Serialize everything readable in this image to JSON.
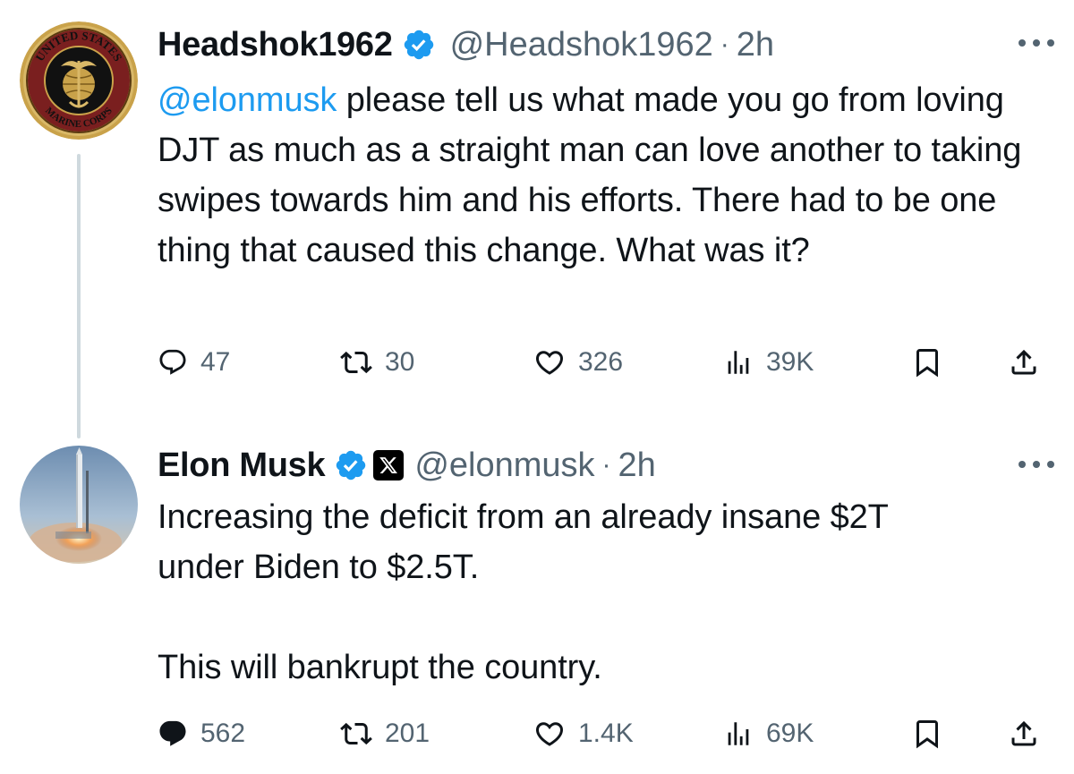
{
  "tweets": [
    {
      "author": {
        "display_name": "Headshok1962",
        "handle": "@Headshok1962",
        "verified": true,
        "avatar": "usmc-seal-avatar",
        "avatar_text_top": "UNITED STATES",
        "avatar_text_bottom": "MARINE CORPS"
      },
      "separator": "·",
      "time": "2h",
      "text": {
        "mention": "@elonmusk",
        "body": " please tell us what made you go from loving DJT as much as a straight man can love another to taking swipes towards him and his efforts.  There had to be one thing that caused this change.  What was it?"
      },
      "stats": {
        "replies": "47",
        "reposts": "30",
        "likes": "326",
        "views": "39K"
      }
    },
    {
      "author": {
        "display_name": "Elon Musk",
        "handle": "@elonmusk",
        "verified": true,
        "affiliation_icon": "x-logo-icon",
        "avatar": "rocket-launch-avatar"
      },
      "separator": "·",
      "time": "2h",
      "text": {
        "body": "Increasing the deficit from an already insane $2T\nunder Biden to $2.5T.\n\nThis will bankrupt the country."
      },
      "stats": {
        "replies": "562",
        "reposts": "201",
        "likes": "1.4K",
        "views": "69K"
      }
    }
  ],
  "colors": {
    "text": "#0f1419",
    "secondary": "#536471",
    "link": "#1d9bf0",
    "verified": "#1d9bf0",
    "thread_line": "#cfd9de"
  }
}
